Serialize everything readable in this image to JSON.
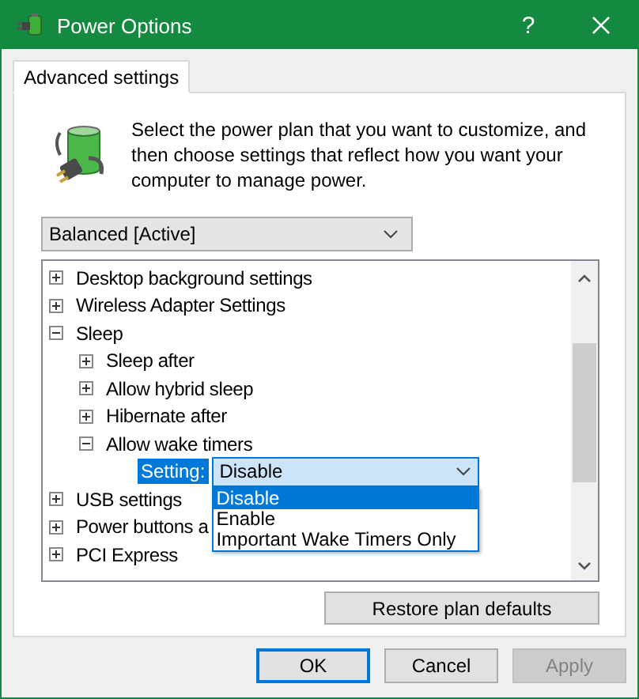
{
  "window": {
    "title": "Power Options",
    "help": "?"
  },
  "tabs": [
    {
      "label": "Advanced settings",
      "selected": true
    }
  ],
  "description": "Select the power plan that you want to customize, and then choose settings that reflect how you want your computer to manage power.",
  "plan": {
    "value": "Balanced [Active]"
  },
  "tree": [
    {
      "label": "Desktop background settings",
      "expanded": false
    },
    {
      "label": "Wireless Adapter Settings",
      "expanded": false
    },
    {
      "label": "Sleep",
      "expanded": true,
      "children": [
        {
          "label": "Sleep after",
          "expanded": false
        },
        {
          "label": "Allow hybrid sleep",
          "expanded": false
        },
        {
          "label": "Hibernate after",
          "expanded": false
        },
        {
          "label": "Allow wake timers",
          "expanded": true,
          "setting": {
            "label": "Setting:",
            "value": "Disable",
            "open": true,
            "options": [
              {
                "label": "Disable",
                "selected": true
              },
              {
                "label": "Enable",
                "selected": false
              },
              {
                "label": "Important Wake Timers Only",
                "selected": false
              }
            ]
          }
        }
      ]
    },
    {
      "label": "USB settings",
      "expanded": false
    },
    {
      "label": "Power buttons a",
      "expanded": false
    },
    {
      "label": "PCI Express",
      "expanded": false
    }
  ],
  "restore_button": "Restore plan defaults",
  "buttons": [
    {
      "label": "OK",
      "kind": "default",
      "disabled": false
    },
    {
      "label": "Cancel",
      "kind": "normal",
      "disabled": false
    },
    {
      "label": "Apply",
      "kind": "normal",
      "disabled": true
    }
  ]
}
